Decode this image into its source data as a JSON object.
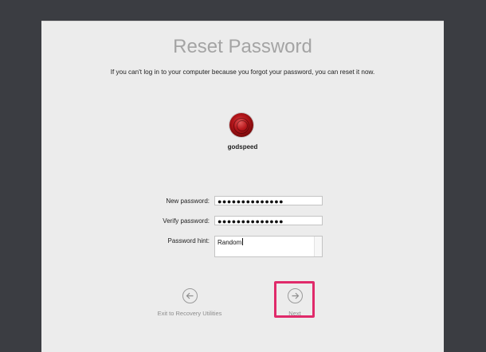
{
  "header": {
    "title": "Reset Password",
    "subtitle": "If you can't log in to your computer because you forgot your password, you can reset it now."
  },
  "user": {
    "name": "godspeed"
  },
  "form": {
    "new_password_label": "New password:",
    "new_password_value": "●●●●●●●●●●●●●●",
    "verify_password_label": "Verify password:",
    "verify_password_value": "●●●●●●●●●●●●●●",
    "hint_label": "Password hint:",
    "hint_value": "Random"
  },
  "nav": {
    "back_label": "Exit to Recovery Utilities",
    "next_label": "Next"
  },
  "colors": {
    "highlight": "#e02a6a",
    "background": "#3b3d42",
    "panel": "#ececec"
  }
}
